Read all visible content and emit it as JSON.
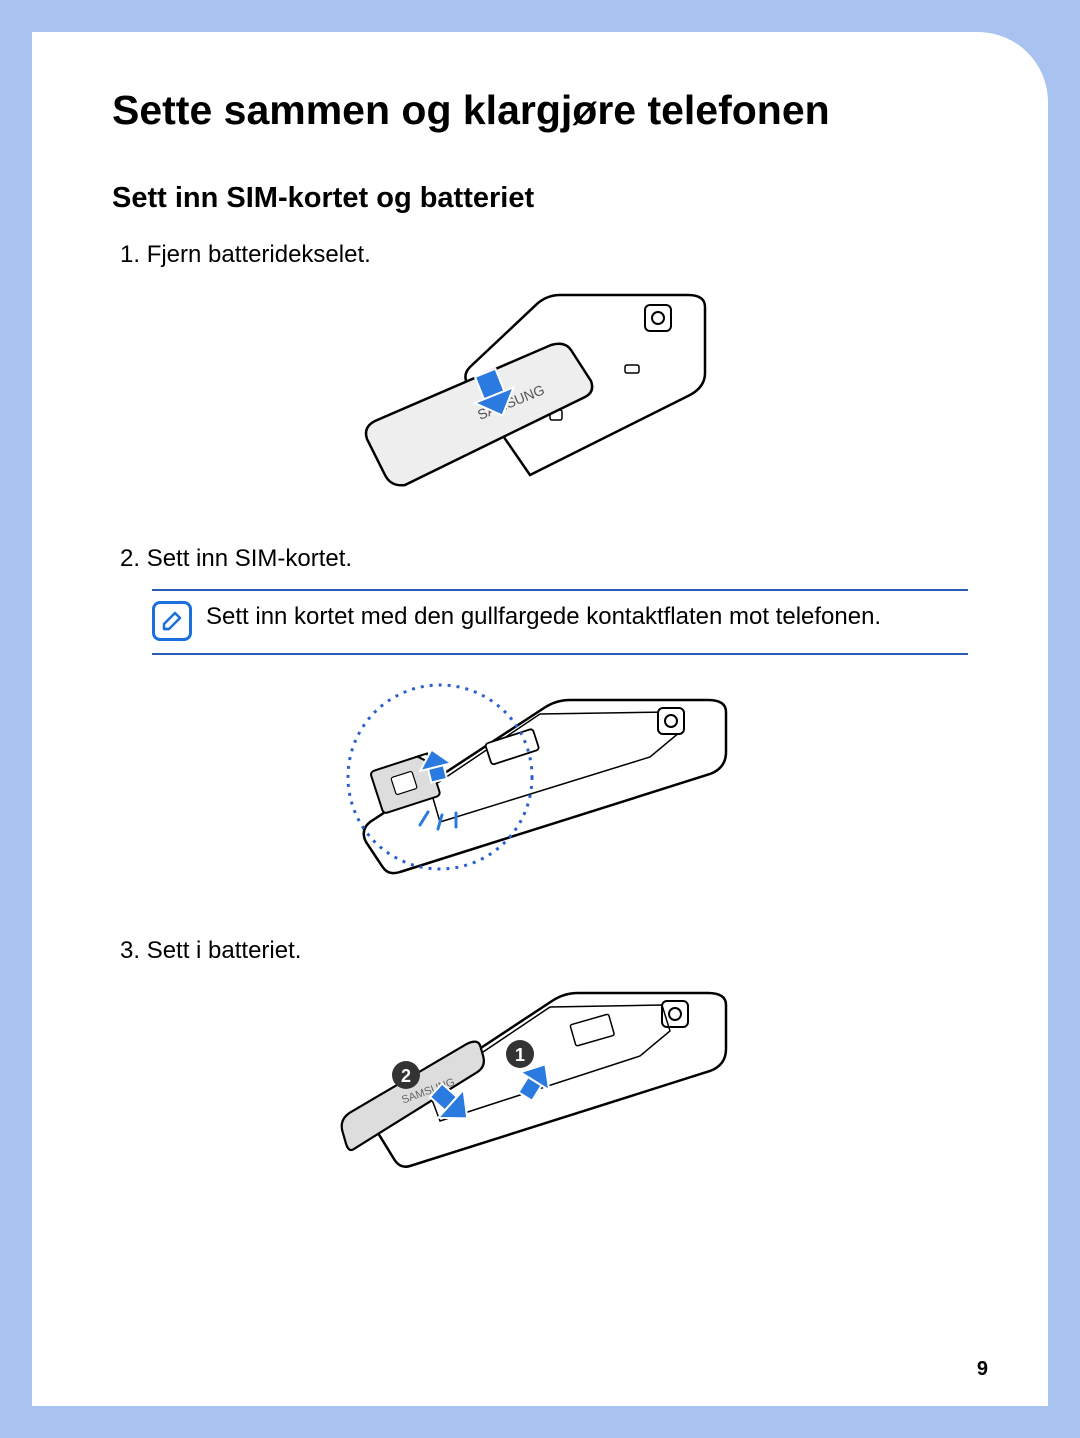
{
  "title": "Sette sammen og klargjøre telefonen",
  "section1": {
    "heading": "Sett inn SIM-kortet og batteriet",
    "step1_num": "1.",
    "step1_text": "Fjern batteridekselet.",
    "step2_num": "2.",
    "step2_text": "Sett inn SIM-kortet.",
    "note": "Sett inn kortet med den gullfargede kontaktflaten mot telefonen.",
    "step3_num": "3.",
    "step3_text": "Sett i batteriet."
  },
  "page_number": "9",
  "brand_on_cover": "SAMSUNG"
}
